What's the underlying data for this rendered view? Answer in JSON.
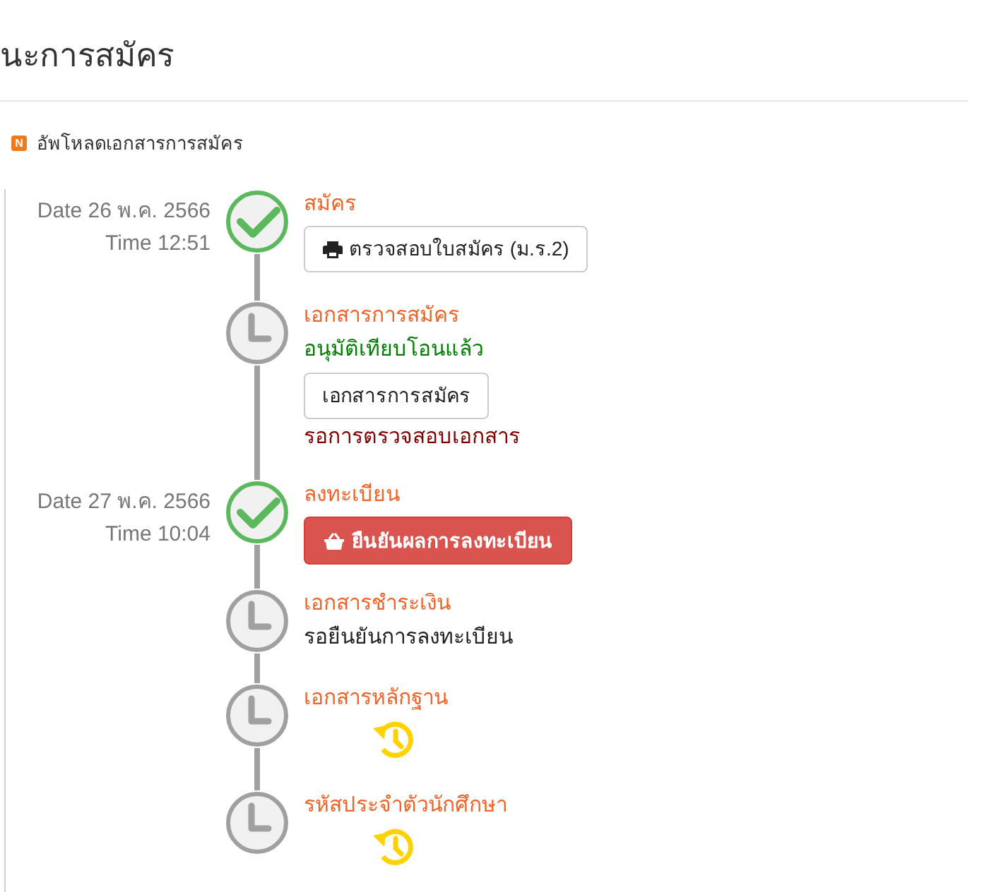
{
  "page_title": "นะการสมัคร",
  "notice": {
    "badge": "N",
    "text": "อัพโหลดเอกสารการสมัคร"
  },
  "steps": [
    {
      "done": true,
      "date": "Date 26 พ.ค. 2566",
      "time": "Time 12:51",
      "title": "สมัคร",
      "items": [
        {
          "kind": "print",
          "label": "ตรวจสอบใบสมัคร (ม.ร.2)"
        }
      ]
    },
    {
      "done": false,
      "title": "เอกสารการสมัคร",
      "items": [
        {
          "kind": "status",
          "color": "#008000",
          "text": "อนุมัติเทียบโอนแล้ว"
        },
        {
          "kind": "plain",
          "label": "เอกสารการสมัคร"
        },
        {
          "kind": "status",
          "color": "#800000",
          "text": "รอการตรวจสอบเอกสาร"
        }
      ]
    },
    {
      "done": true,
      "date": "Date 27 พ.ค. 2566",
      "time": "Time 10:04",
      "title": "ลงทะเบียน",
      "items": [
        {
          "kind": "confirm",
          "label": "ยืนยันผลการลงทะเบียน"
        }
      ]
    },
    {
      "done": false,
      "title": "เอกสารชำระเงิน",
      "items": [
        {
          "kind": "status",
          "color": "#222222",
          "text": "รอยืนยันการลงทะเบียน"
        }
      ]
    },
    {
      "done": false,
      "title": "เอกสารหลักฐาน",
      "items": [
        {
          "kind": "waiting"
        }
      ]
    },
    {
      "done": false,
      "title": "รหัสประจำตัวนักศึกษา",
      "items": [
        {
          "kind": "waiting"
        }
      ]
    }
  ]
}
